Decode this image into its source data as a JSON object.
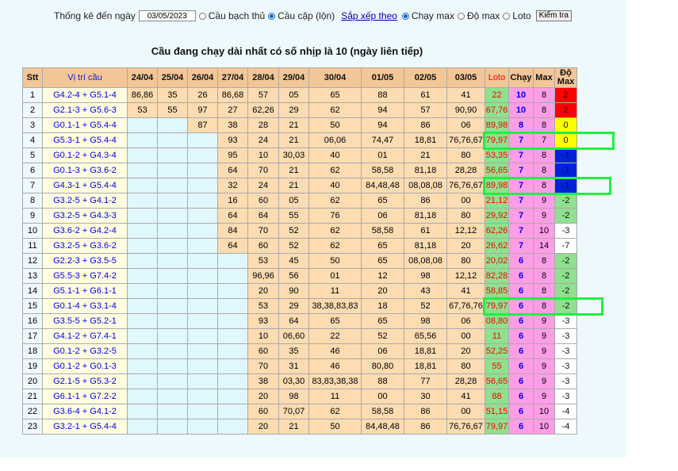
{
  "filter": {
    "label": "Thống kê đến ngày",
    "date_value": "03/05/2023",
    "options": [
      {
        "label": "Cầu bạch thủ",
        "checked": false
      },
      {
        "label": "Cầu cặp (lộn)",
        "checked": true
      }
    ],
    "sort_label": "Sắp xếp theo",
    "sort_options": [
      {
        "label": "Chạy max",
        "checked": true
      },
      {
        "label": "Độ max",
        "checked": false
      },
      {
        "label": "Loto",
        "checked": false
      }
    ],
    "button_label": "Kiểm tra"
  },
  "title": "Cầu đang chạy dài nhất có số nhịp là 10 (ngày liên tiếp)",
  "table": {
    "headers": [
      "Stt",
      "Vị trí cầu",
      "24/04",
      "25/04",
      "26/04",
      "27/04",
      "28/04",
      "29/04",
      "30/04",
      "01/05",
      "02/05",
      "03/05",
      "Loto",
      "Chạy",
      "Max",
      "Độ Max"
    ],
    "rows": [
      {
        "stt": "1",
        "vitri": "G4.2-4 + G5.1-4",
        "days": [
          "86,86",
          "35",
          "26",
          "86,68",
          "57",
          "05",
          "65",
          "88",
          "61",
          "41"
        ],
        "loto": "22",
        "chay": "10",
        "max": "8",
        "domax": "2",
        "domax_color": "red"
      },
      {
        "stt": "2",
        "vitri": "G2.1-3 + G5.6-3",
        "days": [
          "53",
          "55",
          "97",
          "27",
          "62,26",
          "29",
          "62",
          "94",
          "57",
          "90,90"
        ],
        "loto": "67,76",
        "chay": "10",
        "max": "8",
        "domax": "2",
        "domax_color": "red"
      },
      {
        "stt": "3",
        "vitri": "G0.1-1 + G5.4-4",
        "days": [
          "",
          "",
          "87",
          "38",
          "28",
          "21",
          "50",
          "94",
          "86",
          "06"
        ],
        "loto": "89,98",
        "chay": "8",
        "max": "8",
        "domax": "0",
        "domax_color": "yellow"
      },
      {
        "stt": "4",
        "vitri": "G5.3-1 + G5.4-4",
        "days": [
          "",
          "",
          "",
          "93",
          "24",
          "21",
          "06,06",
          "74,47",
          "18,81",
          "76,76,67"
        ],
        "loto": "79,97",
        "chay": "7",
        "max": "7",
        "domax": "0",
        "domax_color": "yellow"
      },
      {
        "stt": "5",
        "vitri": "G0.1-2 + G4.3-4",
        "days": [
          "",
          "",
          "",
          "95",
          "10",
          "30,03",
          "40",
          "01",
          "21",
          "80"
        ],
        "loto": "53,35",
        "chay": "7",
        "max": "8",
        "domax": "-1",
        "domax_color": "blue"
      },
      {
        "stt": "6",
        "vitri": "G0.1-3 + G3.6-2",
        "days": [
          "",
          "",
          "",
          "64",
          "70",
          "21",
          "62",
          "58,58",
          "81,18",
          "28,28"
        ],
        "loto": "56,65",
        "chay": "7",
        "max": "8",
        "domax": "-1",
        "domax_color": "blue"
      },
      {
        "stt": "7",
        "vitri": "G4.3-1 + G5.4-4",
        "days": [
          "",
          "",
          "",
          "32",
          "24",
          "21",
          "40",
          "84,48,48",
          "08,08,08",
          "76,76,67"
        ],
        "loto": "89,98",
        "chay": "7",
        "max": "8",
        "domax": "-1",
        "domax_color": "blue"
      },
      {
        "stt": "8",
        "vitri": "G3.2-5 + G4.1-2",
        "days": [
          "",
          "",
          "",
          "16",
          "60",
          "05",
          "62",
          "65",
          "86",
          "00"
        ],
        "loto": "21,12",
        "chay": "7",
        "max": "9",
        "domax": "-2",
        "domax_color": "green"
      },
      {
        "stt": "9",
        "vitri": "G3.2-5 + G4.3-3",
        "days": [
          "",
          "",
          "",
          "64",
          "64",
          "55",
          "76",
          "06",
          "81,18",
          "80"
        ],
        "loto": "29,92",
        "chay": "7",
        "max": "9",
        "domax": "-2",
        "domax_color": "green"
      },
      {
        "stt": "10",
        "vitri": "G3.6-2 + G4.2-4",
        "days": [
          "",
          "",
          "",
          "84",
          "70",
          "52",
          "62",
          "58,58",
          "61",
          "12,12"
        ],
        "loto": "62,26",
        "chay": "7",
        "max": "10",
        "domax": "-3",
        "domax_color": "white"
      },
      {
        "stt": "11",
        "vitri": "G3.2-5 + G3.6-2",
        "days": [
          "",
          "",
          "",
          "64",
          "60",
          "52",
          "62",
          "65",
          "81,18",
          "20"
        ],
        "loto": "26,62",
        "chay": "7",
        "max": "14",
        "domax": "-7",
        "domax_color": "white"
      },
      {
        "stt": "12",
        "vitri": "G2.2-3 + G3.5-5",
        "days": [
          "",
          "",
          "",
          "",
          "53",
          "45",
          "50",
          "65",
          "08,08,08",
          "80"
        ],
        "loto": "20,02",
        "chay": "6",
        "max": "8",
        "domax": "-2",
        "domax_color": "green"
      },
      {
        "stt": "13",
        "vitri": "G5.5-3 + G7.4-2",
        "days": [
          "",
          "",
          "",
          "",
          "96,96",
          "56",
          "01",
          "12",
          "98",
          "12,12"
        ],
        "loto": "82,28",
        "chay": "6",
        "max": "8",
        "domax": "-2",
        "domax_color": "green"
      },
      {
        "stt": "14",
        "vitri": "G5.1-1 + G6.1-1",
        "days": [
          "",
          "",
          "",
          "",
          "20",
          "90",
          "11",
          "20",
          "43",
          "41"
        ],
        "loto": "58,85",
        "chay": "6",
        "max": "8",
        "domax": "-2",
        "domax_color": "green"
      },
      {
        "stt": "15",
        "vitri": "G0.1-4 + G3.1-4",
        "days": [
          "",
          "",
          "",
          "",
          "53",
          "29",
          "38,38,83,83",
          "18",
          "52",
          "67,76,76"
        ],
        "loto": "79,97",
        "chay": "6",
        "max": "8",
        "domax": "-2",
        "domax_color": "green"
      },
      {
        "stt": "16",
        "vitri": "G3.5-5 + G5.2-1",
        "days": [
          "",
          "",
          "",
          "",
          "93",
          "64",
          "65",
          "65",
          "98",
          "06"
        ],
        "loto": "08,80",
        "chay": "6",
        "max": "9",
        "domax": "-3",
        "domax_color": "white"
      },
      {
        "stt": "17",
        "vitri": "G4.1-2 + G7.4-1",
        "days": [
          "",
          "",
          "",
          "",
          "10",
          "06,60",
          "22",
          "52",
          "65,56",
          "00"
        ],
        "loto": "11",
        "chay": "6",
        "max": "9",
        "domax": "-3",
        "domax_color": "white"
      },
      {
        "stt": "18",
        "vitri": "G0.1-2 + G3.2-5",
        "days": [
          "",
          "",
          "",
          "",
          "60",
          "35",
          "46",
          "06",
          "18,81",
          "20"
        ],
        "loto": "52,25",
        "chay": "6",
        "max": "9",
        "domax": "-3",
        "domax_color": "white"
      },
      {
        "stt": "19",
        "vitri": "G0.1-2 + G0.1-3",
        "days": [
          "",
          "",
          "",
          "",
          "70",
          "31",
          "46",
          "80,80",
          "18,81",
          "80"
        ],
        "loto": "55",
        "chay": "6",
        "max": "9",
        "domax": "-3",
        "domax_color": "white"
      },
      {
        "stt": "20",
        "vitri": "G2.1-5 + G5.3-2",
        "days": [
          "",
          "",
          "",
          "",
          "38",
          "03,30",
          "83,83,38,38",
          "88",
          "77",
          "28,28"
        ],
        "loto": "56,65",
        "chay": "6",
        "max": "9",
        "domax": "-3",
        "domax_color": "white"
      },
      {
        "stt": "21",
        "vitri": "G6.1-1 + G7.2-2",
        "days": [
          "",
          "",
          "",
          "",
          "20",
          "98",
          "11",
          "00",
          "30",
          "41"
        ],
        "loto": "88",
        "chay": "6",
        "max": "9",
        "domax": "-3",
        "domax_color": "white"
      },
      {
        "stt": "22",
        "vitri": "G3.6-4 + G4.1-2",
        "days": [
          "",
          "",
          "",
          "",
          "60",
          "70,07",
          "62",
          "58,58",
          "86",
          "00"
        ],
        "loto": "51,15",
        "chay": "6",
        "max": "10",
        "domax": "-4",
        "domax_color": "white"
      },
      {
        "stt": "23",
        "vitri": "G3.2-1 + G5.4-4",
        "days": [
          "",
          "",
          "",
          "",
          "20",
          "21",
          "50",
          "84,48,48",
          "86",
          "76,76,67"
        ],
        "loto": "79,97",
        "chay": "6",
        "max": "10",
        "domax": "-4",
        "domax_color": "white"
      }
    ]
  },
  "highlight_color": "#22ee44",
  "highlighted_rows": [
    "4",
    "7",
    "15"
  ]
}
